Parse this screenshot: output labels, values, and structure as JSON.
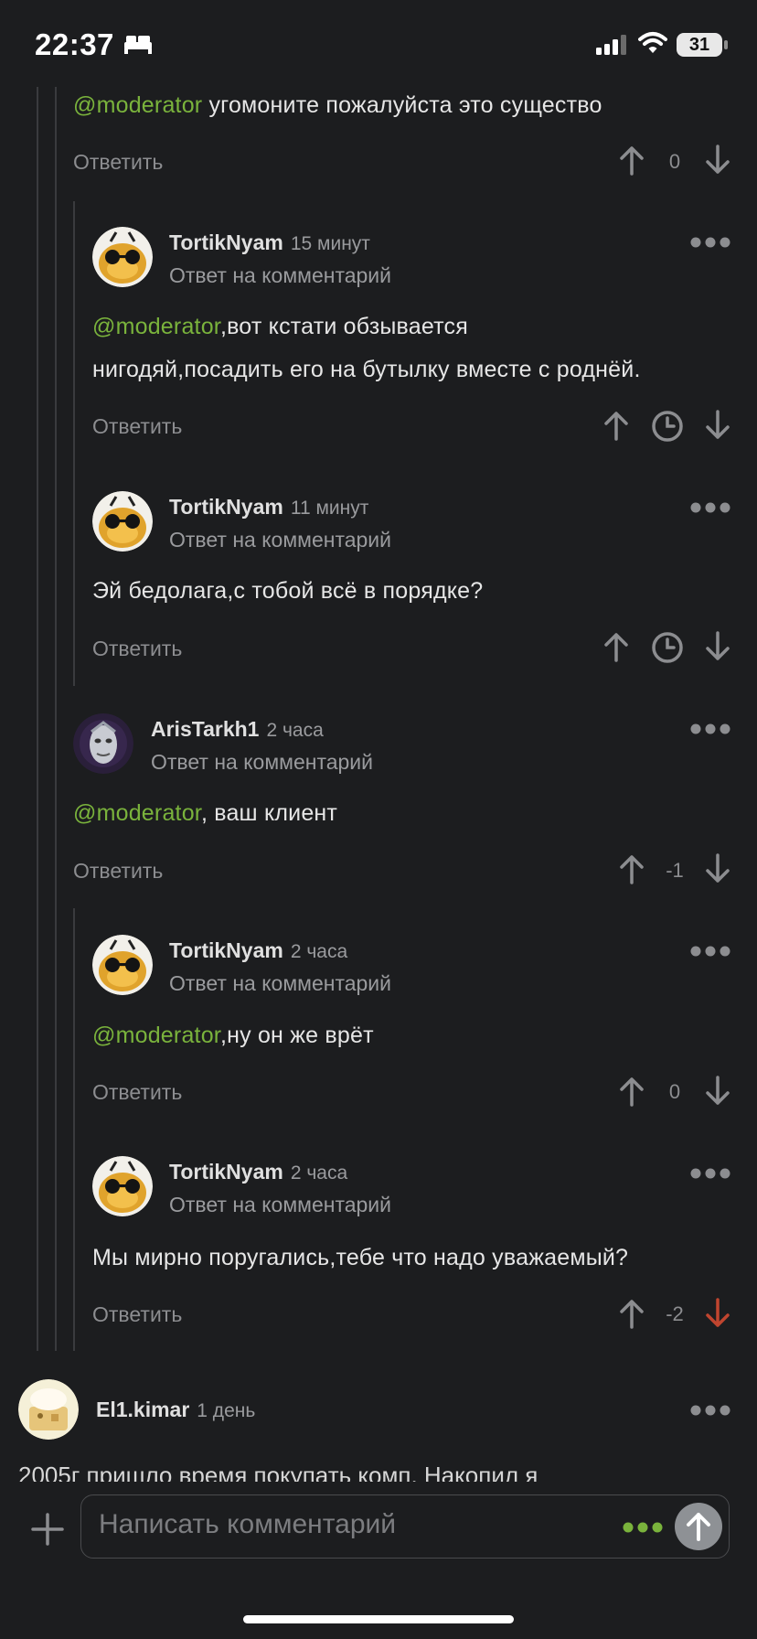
{
  "status_bar": {
    "time": "22:37",
    "battery": "31"
  },
  "ui": {
    "reply": "Ответить",
    "reply_to_comment": "Ответ на комментарий",
    "composer_placeholder": "Написать комментарий"
  },
  "comments": [
    {
      "mention": "@moderator",
      "text": " угомоните пожалуйста это существо",
      "score": "0"
    },
    {
      "author": "TortikNyam",
      "time": "15 минут",
      "mention": "@moderator",
      "line1": ",вот кстати обзывается",
      "line2": "нигодяй,посадить его на бутылку вместе с роднёй."
    },
    {
      "author": "TortikNyam",
      "time": "11 минут",
      "text": "Эй бедолага,с тобой всё в порядке?"
    },
    {
      "author": "ArisTarkh1",
      "time": "2 часа",
      "mention": "@moderator",
      "text": ", ваш клиент",
      "score": "-1"
    },
    {
      "author": "TortikNyam",
      "time": "2 часа",
      "mention": "@moderator",
      "text": ",ну он же врёт",
      "score": "0"
    },
    {
      "author": "TortikNyam",
      "time": "2 часа",
      "text": "Мы мирно поругались,тебе что надо уважаемый?",
      "score": "-2"
    },
    {
      "author": "El1.kimar",
      "time": "1 день",
      "text_partial": "2005г пришло время покупать комп. Накопил я"
    }
  ],
  "colors": {
    "mention": "#7ab33c",
    "downvote_active": "#c0452f",
    "background": "#1c1d1f"
  }
}
